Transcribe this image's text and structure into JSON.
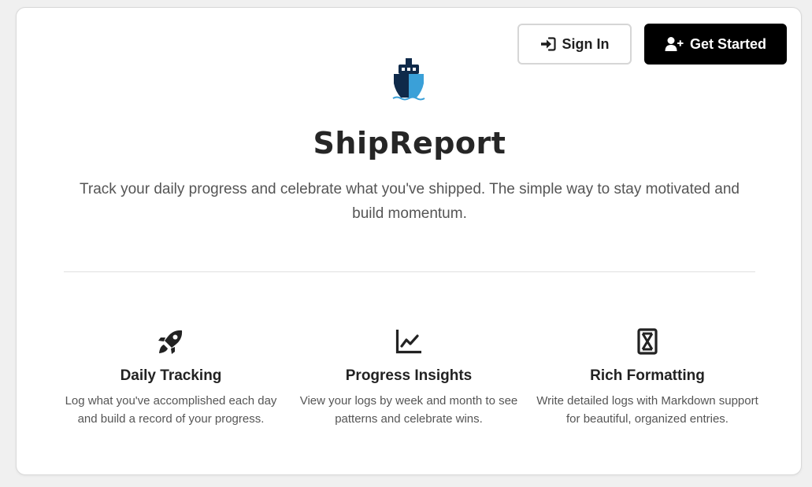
{
  "header": {
    "sign_in_label": "Sign In",
    "get_started_label": "Get Started",
    "sign_in_icon": "sign-in-icon",
    "get_started_icon": "user-plus-icon"
  },
  "hero": {
    "logo_icon": "ship-icon",
    "title": "ShipReport",
    "tagline": "Track your daily progress and celebrate what you've shipped. The simple way to stay motivated and build momentum."
  },
  "features": [
    {
      "icon": "rocket-icon",
      "heading": "Daily Tracking",
      "description": "Log what you've accomplished each day and build a record of your progress."
    },
    {
      "icon": "line-chart-icon",
      "heading": "Progress Insights",
      "description": "View your logs by week and month to see patterns and celebrate wins."
    },
    {
      "icon": "markdown-icon",
      "heading": "Rich Formatting",
      "description": "Write detailed logs with Markdown support for beautiful, organized entries."
    }
  ],
  "colors": {
    "primary_button_bg": "#000000",
    "primary_button_text": "#ffffff",
    "logo_dark": "#0f2a4a",
    "logo_light": "#3aa0d8",
    "text_dark": "#262626",
    "text_muted": "#555555"
  }
}
